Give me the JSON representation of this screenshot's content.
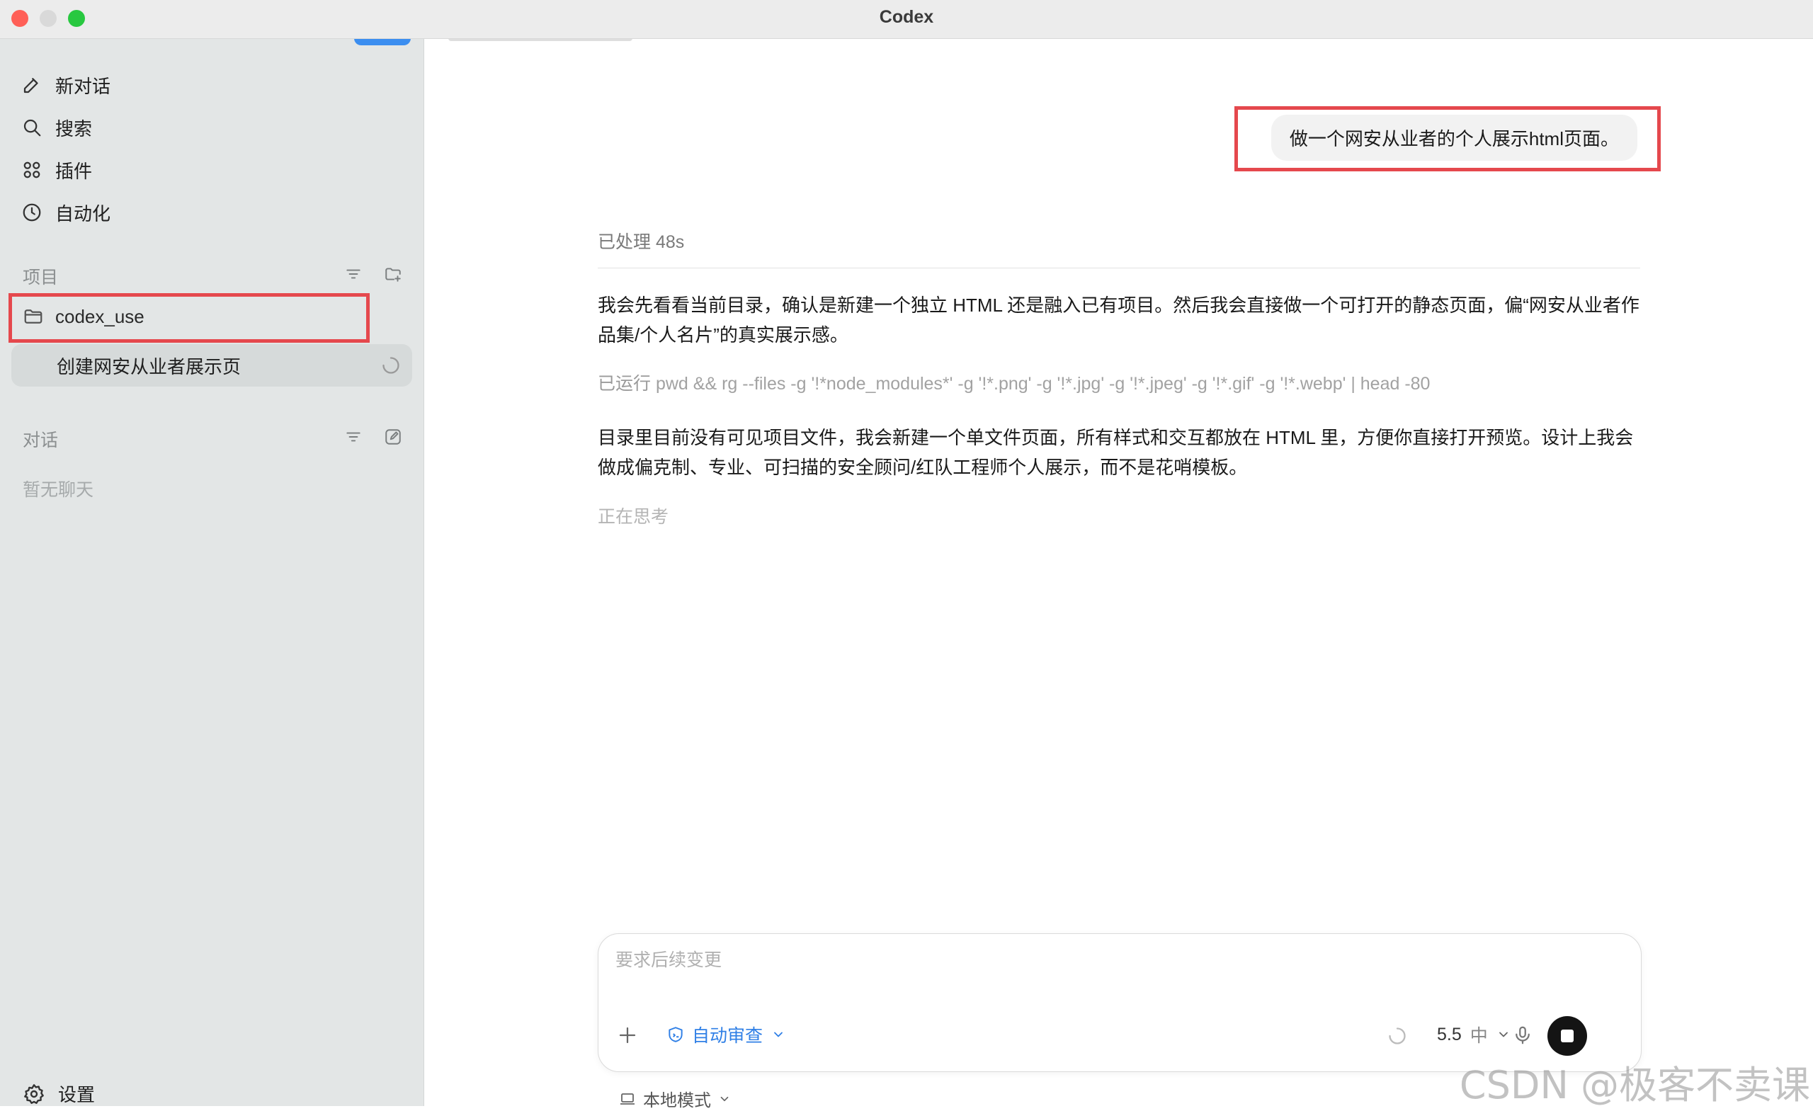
{
  "window": {
    "title": "Codex"
  },
  "sidebar": {
    "nav": [
      {
        "label": "新对话",
        "icon": "edit-icon"
      },
      {
        "label": "搜索",
        "icon": "search-icon"
      },
      {
        "label": "插件",
        "icon": "grid-icon"
      },
      {
        "label": "自动化",
        "icon": "clock-icon"
      }
    ],
    "projects_heading": "项目",
    "project": {
      "name": "codex_use"
    },
    "thread": {
      "title": "创建网安从业者展示页"
    },
    "conversations_heading": "对话",
    "conversations_empty": "暂无聊天",
    "settings_label": "设置"
  },
  "chat": {
    "user_message": "做一个网安从业者的个人展示html页面。",
    "processed": "已处理 48s",
    "assistant_1": "我会先看看当前目录，确认是新建一个独立 HTML 还是融入已有项目。然后我会直接做一个可打开的静态页面，偏“网安从业者作品集/个人名片”的真实展示感。",
    "command_label": "已运行",
    "command": "pwd && rg --files -g '!*node_modules*' -g '!*.png' -g '!*.jpg' -g '!*.jpeg' -g '!*.gif' -g '!*.webp' | head -80",
    "assistant_2": "目录里目前没有可见项目文件，我会新建一个单文件页面，所有样式和交互都放在 HTML 里，方便你直接打开预览。设计上我会做成偏克制、专业、可扫描的安全顾问/红队工程师个人展示，而不是花哨模板。",
    "thinking": "正在思考"
  },
  "composer": {
    "placeholder": "要求后续变更",
    "review_label": "自动审查",
    "model": "5.5",
    "effort": "中",
    "mode_label": "本地模式"
  },
  "watermark": "CSDN @极客不卖课",
  "colors": {
    "accent": "#2f7fe6",
    "highlight": "#e5484d",
    "sidebar_bg": "#e3e6e6"
  }
}
